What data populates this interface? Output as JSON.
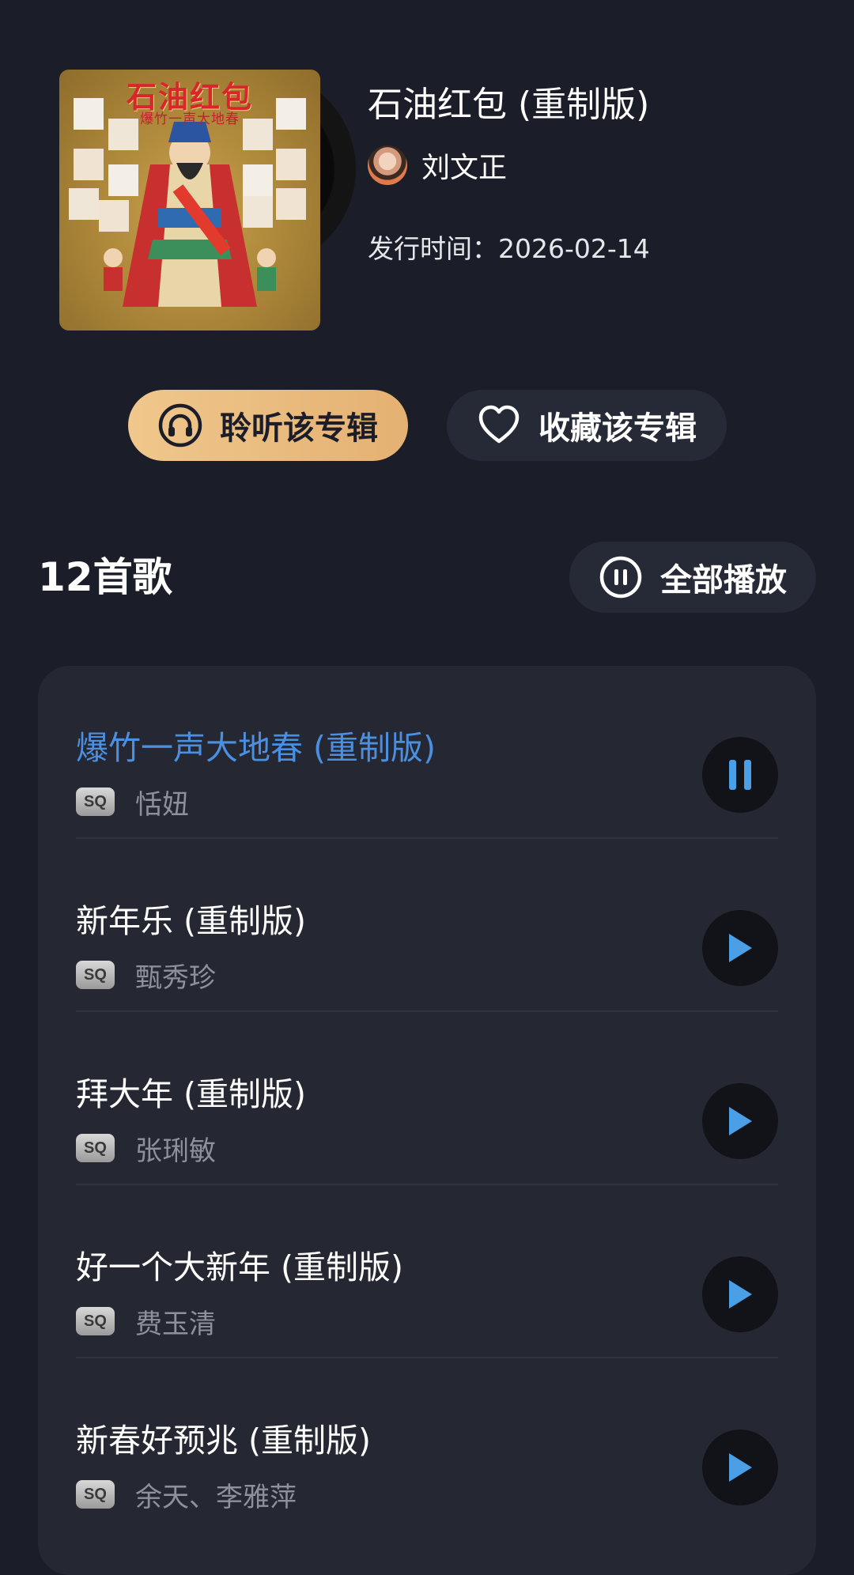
{
  "album": {
    "cover_title": "石油红包",
    "cover_subtitle": "爆竹一声大地春",
    "title": "石油红包 (重制版)",
    "artist": "刘文正",
    "release_label": "发行时间：",
    "release_date": "2026-02-14"
  },
  "actions": {
    "listen_label": "聆听该专辑",
    "favorite_label": "收藏该专辑"
  },
  "songs_header": {
    "count_label": "12首歌",
    "play_all_label": "全部播放"
  },
  "songs": [
    {
      "title": "爆竹一声大地春 (重制版)",
      "quality": "SQ",
      "artist": "恬妞",
      "state": "playing"
    },
    {
      "title": "新年乐 (重制版)",
      "quality": "SQ",
      "artist": "甄秀珍",
      "state": "paused"
    },
    {
      "title": "拜大年 (重制版)",
      "quality": "SQ",
      "artist": "张琍敏",
      "state": "paused"
    },
    {
      "title": "好一个大新年 (重制版)",
      "quality": "SQ",
      "artist": "费玉清",
      "state": "paused"
    },
    {
      "title": "新春好预兆 (重制版)",
      "quality": "SQ",
      "artist": "余天、李雅萍",
      "state": "paused"
    }
  ],
  "colors": {
    "background": "#1b1e28",
    "card": "#252833",
    "accent_gold": "#e9bb7e",
    "active_song": "#4a8fe0",
    "play_icon": "#4a9fe6"
  },
  "icons": {
    "listen": "headphones-icon",
    "favorite": "heart-icon",
    "play_all": "pause-circle-icon",
    "song_playing": "pause-icon",
    "song_idle": "play-icon"
  }
}
